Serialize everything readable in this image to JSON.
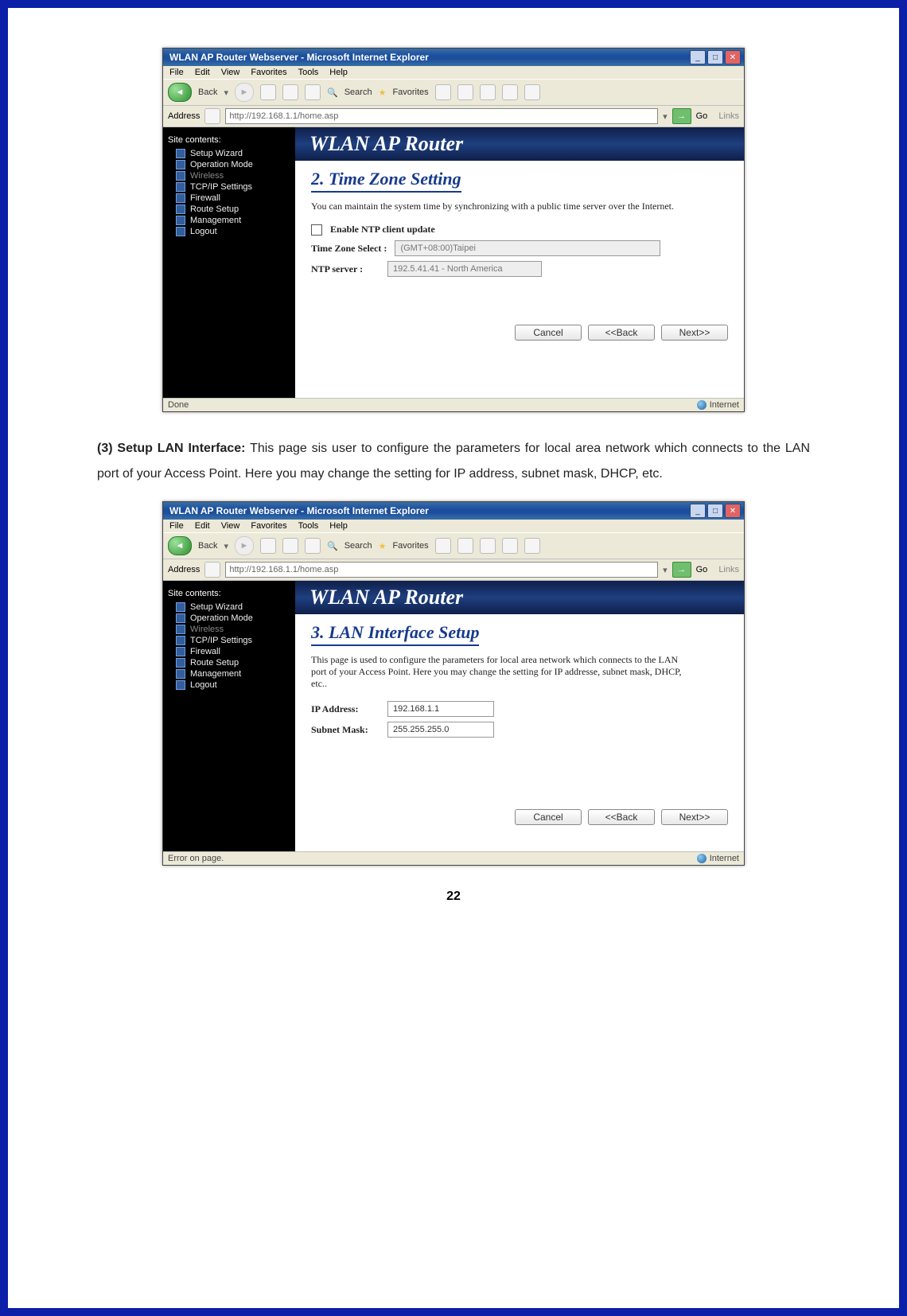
{
  "page_number": "22",
  "paragraph": {
    "lead": "(3) Setup LAN Interface:",
    "text": " This page sis user to configure the parameters for local area network which connects to the LAN port of your Access Point. Here you may change the setting for IP address, subnet mask, DHCP, etc."
  },
  "ie": {
    "title": "WLAN AP Router Webserver - Microsoft Internet Explorer",
    "menu": [
      "File",
      "Edit",
      "View",
      "Favorites",
      "Tools",
      "Help"
    ],
    "back_label": "Back",
    "search_label": "Search",
    "fav_label": "Favorites",
    "addr_label": "Address",
    "url": "http://192.168.1.1/home.asp",
    "go_label": "Go",
    "links_label": "Links",
    "status_done": "Done",
    "status_error": "Error on page.",
    "zone": "Internet"
  },
  "router": {
    "brand": "WLAN AP Router",
    "sidebar_header": "Site contents:",
    "sidebar_items": [
      {
        "label": "Setup Wizard",
        "dim": false
      },
      {
        "label": "Operation Mode",
        "dim": false
      },
      {
        "label": "Wireless",
        "dim": true
      },
      {
        "label": "TCP/IP Settings",
        "dim": false
      },
      {
        "label": "Firewall",
        "dim": false
      },
      {
        "label": "Route Setup",
        "dim": false
      },
      {
        "label": "Management",
        "dim": false
      },
      {
        "label": "Logout",
        "dim": false
      }
    ]
  },
  "shot1": {
    "heading": "2. Time Zone Setting",
    "desc": "You can maintain the system time by synchronizing with a public time server over the Internet.",
    "enable_label": "Enable NTP client update",
    "tz_label": "Time Zone Select :",
    "tz_value": "(GMT+08:00)Taipei",
    "ntp_label": "NTP server :",
    "ntp_value": "192.5.41.41 - North America",
    "cancel": "Cancel",
    "back": "<<Back",
    "next": "Next>>"
  },
  "shot2": {
    "heading": "3. LAN Interface Setup",
    "desc": "This page is used to configure the parameters for local area network which connects to the LAN port of your Access Point. Here you may change the setting for IP addresse, subnet mask, DHCP, etc..",
    "ip_label": "IP Address:",
    "ip_value": "192.168.1.1",
    "mask_label": "Subnet Mask:",
    "mask_value": "255.255.255.0",
    "cancel": "Cancel",
    "back": "<<Back",
    "next": "Next>>"
  }
}
